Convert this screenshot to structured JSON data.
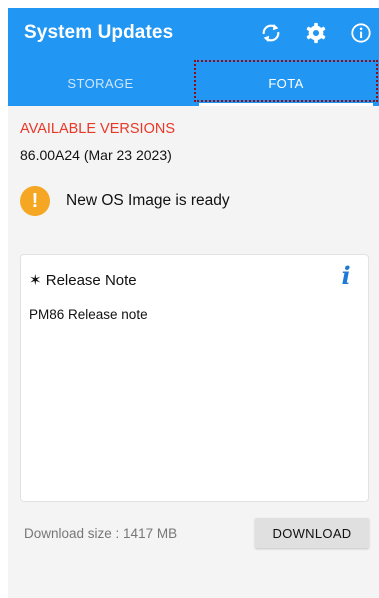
{
  "app_bar": {
    "title": "System Updates",
    "icons": [
      "refresh-icon",
      "gear-icon",
      "info-circle-icon"
    ],
    "color": "#2196f3"
  },
  "tabs": [
    {
      "label": "STORAGE",
      "selected": false
    },
    {
      "label": "FOTA",
      "selected": true
    }
  ],
  "available_versions": {
    "title": "AVAILABLE VERSIONS",
    "version": "86.00A24 (Mar 23 2023)",
    "title_color": "#e83828"
  },
  "status": {
    "icon": "warning-icon",
    "icon_glyph": "!",
    "icon_color": "#f5a623",
    "text": "New OS Image is ready"
  },
  "release_note": {
    "heading": "✶ Release Note",
    "info_glyph": "i",
    "body": "PM86 Release note"
  },
  "download": {
    "size_text": "Download size : 1417 MB",
    "button_label": "DOWNLOAD"
  }
}
